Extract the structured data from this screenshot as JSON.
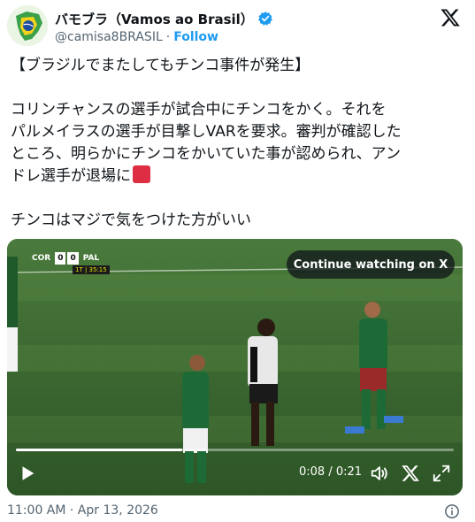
{
  "author": {
    "display_name": "バモブラ（Vamos ao Brasil）",
    "handle": "@camisa8BRASIL",
    "separator": "·",
    "follow_label": "Follow",
    "avatar_icon": "brazil-map-avatar",
    "verified_icon": "verified-badge-icon",
    "verified_color": "#1d9bf0"
  },
  "platform_icon": "x-logo-icon",
  "tweet": {
    "line_1": "【ブラジルでまたしてもチンコ事件が発生】",
    "line_2": "コリンチャンスの選手が試合中にチンコをかく。それを",
    "line_3": "パルメイラスの選手が目撃しVARを要求。審判が確認した",
    "line_4": "ところ、明らかにチンコをかいていた事が認められ、アン",
    "line_5": "ドレ選手が退場に",
    "red_card_icon": "red-square-emoji",
    "line_6": "チンコはマジで気をつけた方がいい"
  },
  "video": {
    "scoreboard": {
      "home_team": "COR",
      "home_score": "0",
      "away_score": "0",
      "away_team": "PAL",
      "match_clock": "1T | 35:15"
    },
    "continue_label": "Continue watching on X",
    "progress_fraction": 0.38,
    "time_display": "0:08 / 0:21",
    "controls": {
      "play_icon": "play-icon",
      "volume_icon": "volume-icon",
      "close_icon": "close-icon",
      "fullscreen_icon": "fullscreen-icon"
    }
  },
  "timestamp": "11:00 AM · Apr 13, 2026",
  "info_icon": "info-icon"
}
